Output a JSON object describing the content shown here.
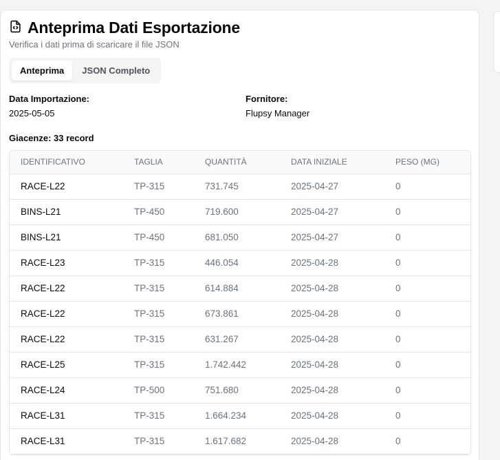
{
  "header": {
    "title": "Anteprima Dati Esportazione",
    "subtitle": "Verifica i dati prima di scaricare il file JSON",
    "icon": "file-code-icon"
  },
  "tabs": [
    {
      "label": "Anteprima",
      "active": true
    },
    {
      "label": "JSON Completo",
      "active": false
    }
  ],
  "meta": {
    "import_date_label": "Data Importazione:",
    "import_date_value": "2025-05-05",
    "supplier_label": "Fornitore:",
    "supplier_value": "Flupsy Manager"
  },
  "record_count": "Giacenze: 33 record",
  "table": {
    "columns": [
      "IDENTIFICATIVO",
      "TAGLIA",
      "QUANTITÀ",
      "DATA INIZIALE",
      "PESO (MG)"
    ],
    "rows": [
      [
        "RACE-L22",
        "TP-315",
        "731.745",
        "2025-04-27",
        "0"
      ],
      [
        "BINS-L21",
        "TP-450",
        "719.600",
        "2025-04-27",
        "0"
      ],
      [
        "BINS-L21",
        "TP-450",
        "681.050",
        "2025-04-27",
        "0"
      ],
      [
        "RACE-L23",
        "TP-315",
        "446.054",
        "2025-04-28",
        "0"
      ],
      [
        "RACE-L22",
        "TP-315",
        "614.884",
        "2025-04-28",
        "0"
      ],
      [
        "RACE-L22",
        "TP-315",
        "673.861",
        "2025-04-28",
        "0"
      ],
      [
        "RACE-L22",
        "TP-315",
        "631.267",
        "2025-04-28",
        "0"
      ],
      [
        "RACE-L25",
        "TP-315",
        "1.742.442",
        "2025-04-28",
        "0"
      ],
      [
        "RACE-L24",
        "TP-500",
        "751.680",
        "2025-04-28",
        "0"
      ],
      [
        "RACE-L31",
        "TP-315",
        "1.664.234",
        "2025-04-28",
        "0"
      ],
      [
        "RACE-L31",
        "TP-315",
        "1.617.682",
        "2025-04-28",
        "0"
      ]
    ]
  }
}
